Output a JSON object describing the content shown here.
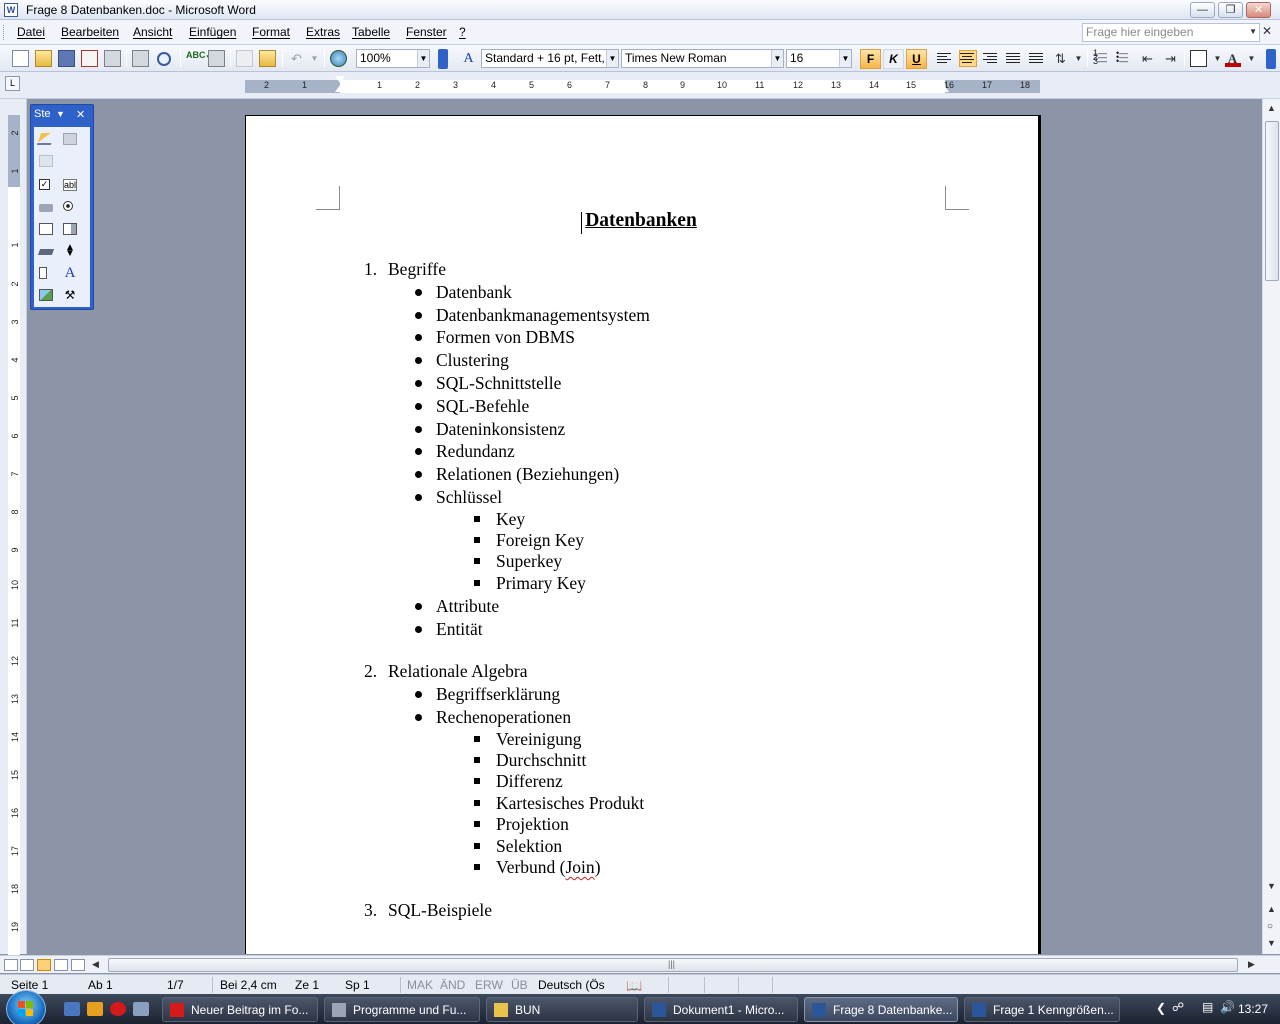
{
  "window": {
    "title": "Frage 8 Datenbanken.doc - Microsoft Word",
    "app_icon_letter": "W"
  },
  "menu": {
    "items": [
      "Datei",
      "Bearbeiten",
      "Ansicht",
      "Einfügen",
      "Format",
      "Extras",
      "Tabelle",
      "Fenster",
      "?"
    ],
    "help_placeholder": "Frage hier eingeben"
  },
  "toolbar": {
    "zoom": "100%",
    "style": "Standard + 16 pt, Fett,",
    "font": "Times New Roman",
    "size": "16",
    "bold_label": "F",
    "italic_label": "K",
    "underline_label": "U",
    "style_icon_glyph": "A",
    "font_color": "#c00000",
    "highlight_color": "#1a3fb0"
  },
  "ruler": {
    "tab_selector": "L",
    "h_labels": [
      "2",
      "1",
      "1",
      "2",
      "3",
      "4",
      "5",
      "6",
      "7",
      "8",
      "9",
      "10",
      "11",
      "12",
      "13",
      "14",
      "15",
      "16",
      "17",
      "18"
    ],
    "v_labels": [
      "2",
      "1",
      "1",
      "2",
      "3",
      "4",
      "5",
      "6",
      "7",
      "8",
      "9",
      "10",
      "11",
      "12",
      "13",
      "14",
      "15",
      "16",
      "17",
      "18",
      "19"
    ]
  },
  "toolbox": {
    "title": "Ste",
    "icon_label_ab": "abl",
    "icon_label_a": "A"
  },
  "document": {
    "title": "Datenbanken",
    "sections": [
      {
        "number": "1.",
        "heading": "Begriffe",
        "items": [
          {
            "text": "Datenbank",
            "sub": []
          },
          {
            "text": "Datenbankmanagementsystem",
            "sub": []
          },
          {
            "text": "Formen von DBMS",
            "sub": []
          },
          {
            "text": "Clustering",
            "sub": []
          },
          {
            "text": "SQL-Schnittstelle",
            "sub": []
          },
          {
            "text": "SQL-Befehle",
            "sub": []
          },
          {
            "text": "Dateninkonsistenz",
            "sub": []
          },
          {
            "text": "Redundanz",
            "sub": []
          },
          {
            "text": "Relationen (Beziehungen)",
            "sub": []
          },
          {
            "text": "Schlüssel",
            "sub": [
              "Key",
              "Foreign Key",
              "Superkey",
              "Primary Key"
            ]
          },
          {
            "text": "Attribute",
            "sub": []
          },
          {
            "text": "Entität",
            "sub": []
          }
        ]
      },
      {
        "number": "2.",
        "heading": "Relationale Algebra",
        "items": [
          {
            "text": "Begriffserklärung",
            "sub": []
          },
          {
            "text": "Rechenoperationen",
            "sub": [
              "Vereinigung",
              "Durchschnitt",
              "Differenz",
              "Kartesisches Produkt",
              "Projektion",
              "Selektion",
              "Verbund (Join)"
            ]
          }
        ]
      },
      {
        "number": "3.",
        "heading": "SQL-Beispiele",
        "items": []
      }
    ]
  },
  "statusbar": {
    "page": "Seite 1",
    "section": "Ab 1",
    "pages": "1/7",
    "position": "Bei 2,4 cm",
    "line": "Ze 1",
    "column": "Sp 1",
    "mak": "MAK",
    "aend": "ÄND",
    "erw": "ERW",
    "ueb": "ÜB",
    "language": "Deutsch (Ös"
  },
  "taskbar": {
    "tasks": [
      {
        "label": "Neuer Beitrag im Fo...",
        "active": false,
        "color": "#d41a1a"
      },
      {
        "label": "Programme und Fu...",
        "active": false,
        "color": "#9aa4b4"
      },
      {
        "label": "BUN",
        "active": false,
        "color": "#e8c24a"
      },
      {
        "label": "Dokument1 - Micro...",
        "active": false,
        "color": "#2b579a"
      },
      {
        "label": "Frage 8 Datenbanke...",
        "active": true,
        "color": "#2b579a"
      },
      {
        "label": "Frage 1 Kenngrößen...",
        "active": false,
        "color": "#2b579a"
      }
    ],
    "clock": "13:27"
  }
}
